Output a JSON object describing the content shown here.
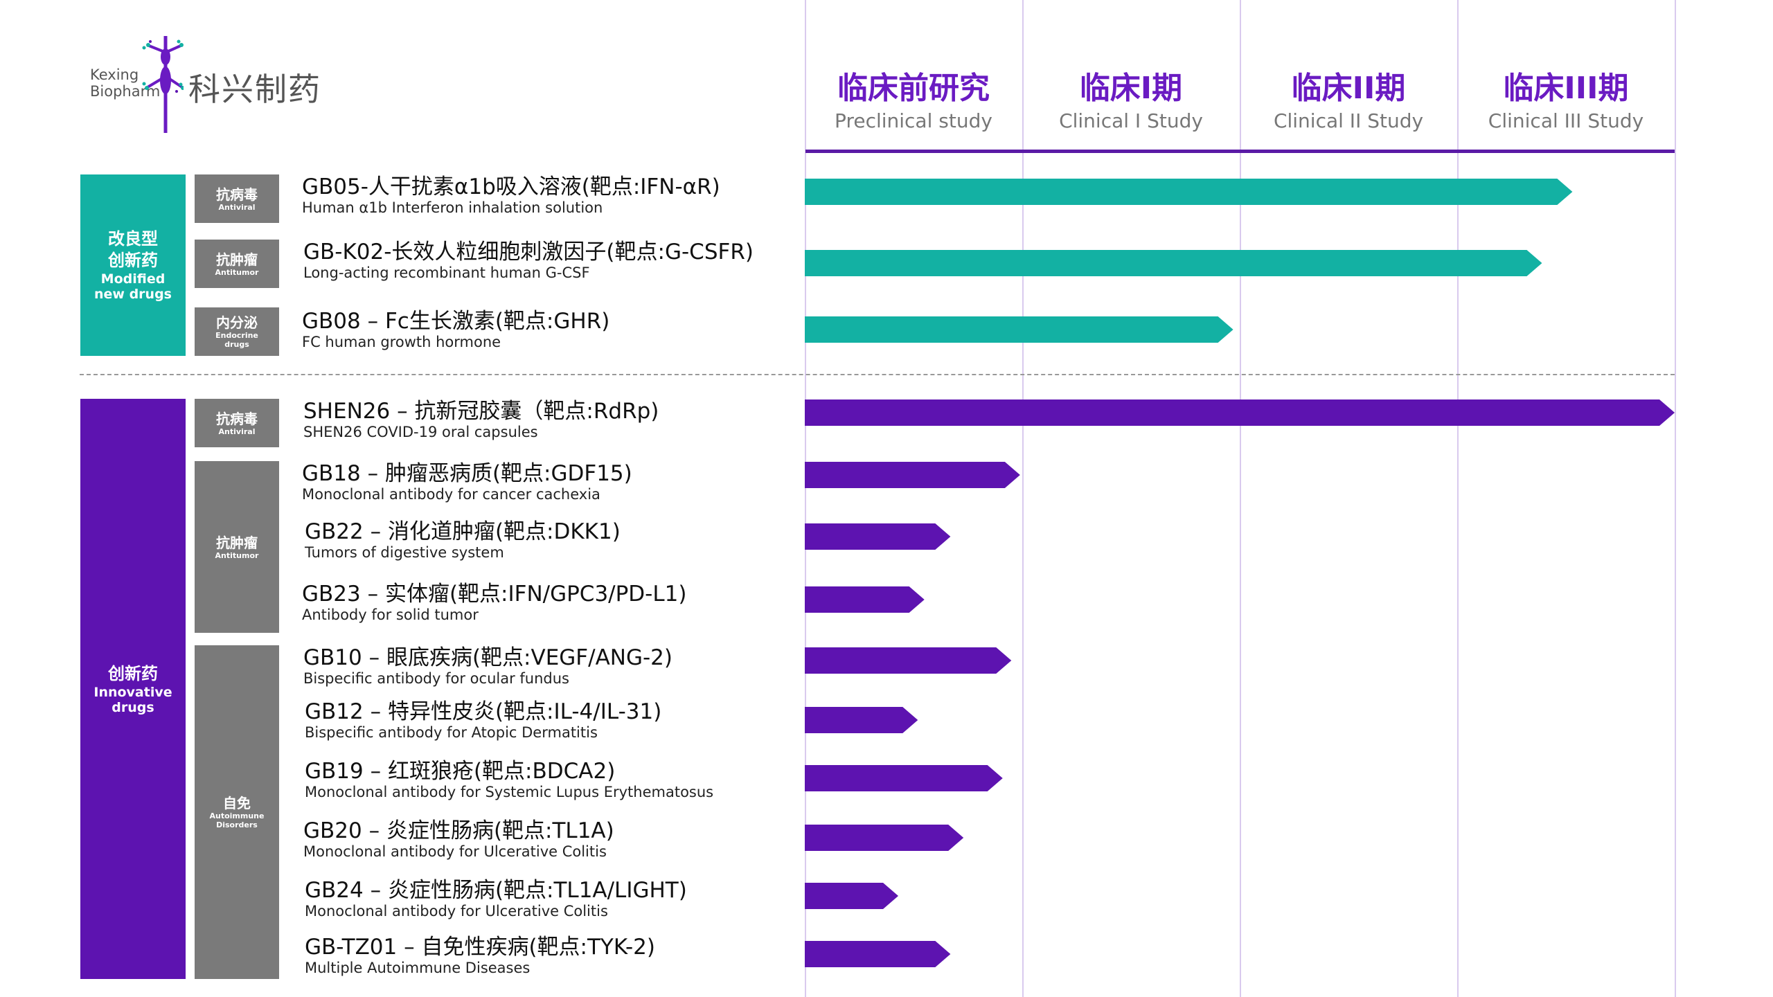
{
  "logo": {
    "en_line1": "Kexing",
    "en_line2": "Biopharm",
    "cn": "科兴制药"
  },
  "phases": [
    {
      "cn": "临床前研究",
      "en": "Preclinical study"
    },
    {
      "cn": "临床I期",
      "en": "Clinical I Study"
    },
    {
      "cn": "临床II期",
      "en": "Clinical II Study"
    },
    {
      "cn": "临床III期",
      "en": "Clinical III Study"
    }
  ],
  "groups": [
    {
      "cn": "改良型\n创新药",
      "en": "Modified\nnew drugs",
      "color": "#13b1a3"
    },
    {
      "cn": "创新药",
      "en": "Innovative\ndrugs",
      "color": "#5d13b0"
    }
  ],
  "categories": [
    {
      "cn": "抗病毒",
      "en": "Antiviral"
    },
    {
      "cn": "抗肿瘤",
      "en": "Antitumor"
    },
    {
      "cn": "内分泌",
      "en": "Endocrine\ndrugs"
    },
    {
      "cn": "抗病毒",
      "en": "Antiviral"
    },
    {
      "cn": "抗肿瘤",
      "en": "Antitumor"
    },
    {
      "cn": "自免",
      "en": "Autoimmune\nDisorders"
    }
  ],
  "colors": {
    "teal": "#13b1a3",
    "purple": "#5d13b0",
    "category": "#7a7a7a",
    "header_purple": "#6a1bc2"
  },
  "chart_data": {
    "type": "bar",
    "orientation": "horizontal",
    "x_unit": "development phase (0-4 = Preclinical, Clinical I, Clinical II, Clinical III)",
    "xlim": [
      0,
      4
    ],
    "categories": [
      "GB05",
      "GB-K02",
      "GB08",
      "SHEN26",
      "GB18",
      "GB22",
      "GB23",
      "GB10",
      "GB12",
      "GB19",
      "GB20",
      "GB24",
      "GB-TZ01"
    ],
    "drugs": [
      {
        "name": "GB05-人干扰素α1b吸入溶液(靶点:IFN-αR)",
        "desc": "Human α1b Interferon inhalation solution",
        "group": 0,
        "progress": 3.53
      },
      {
        "name": "GB-K02-长效人粒细胞刺激因子(靶点:G-CSFR)",
        "desc": "Long-acting  recombinant human G-CSF",
        "group": 0,
        "progress": 3.39
      },
      {
        "name": "GB08 – Fc生长激素(靶点:GHR)",
        "desc": "FC human growth hormone",
        "group": 0,
        "progress": 1.97
      },
      {
        "name": "SHEN26 – 抗新冠胶囊（靶点:RdRp)",
        "desc": "SHEN26 COVID-19 oral capsules",
        "group": 1,
        "progress": 4.0
      },
      {
        "name": "GB18 – 肿瘤恶病质(靶点:GDF15)",
        "desc": "Monoclonal antibody for cancer cachexia",
        "group": 1,
        "progress": 0.99
      },
      {
        "name": "GB22 – 消化道肿瘤(靶点:DKK1)",
        "desc": "Tumors of digestive system",
        "group": 1,
        "progress": 0.67
      },
      {
        "name": "GB23 – 实体瘤(靶点:IFN/GPC3/PD-L1)",
        "desc": "Antibody for solid tumor",
        "group": 1,
        "progress": 0.55
      },
      {
        "name": "GB10 – 眼底疾病(靶点:VEGF/ANG-2)",
        "desc": "Bispecific antibody for ocular fundus",
        "group": 1,
        "progress": 0.95
      },
      {
        "name": "GB12 – 特异性皮炎(靶点:IL-4/IL-31)",
        "desc": "Bispecific antibody for Atopic Dermatitis",
        "group": 1,
        "progress": 0.52
      },
      {
        "name": "GB19 – 红斑狼疮(靶点:BDCA2)",
        "desc": "Monoclonal antibody for Systemic Lupus Erythematosus",
        "group": 1,
        "progress": 0.91
      },
      {
        "name": "GB20 – 炎症性肠病(靶点:TL1A)",
        "desc": "Monoclonal antibody for Ulcerative Colitis",
        "group": 1,
        "progress": 0.73
      },
      {
        "name": "GB24 – 炎症性肠病(靶点:TL1A/LIGHT)",
        "desc": "Monoclonal antibody for Ulcerative Colitis",
        "group": 1,
        "progress": 0.43
      },
      {
        "name": "GB-TZ01 – 自免性疾病(靶点:TYK-2)",
        "desc": "Multiple Autoimmune Diseases",
        "group": 1,
        "progress": 0.67
      }
    ]
  }
}
